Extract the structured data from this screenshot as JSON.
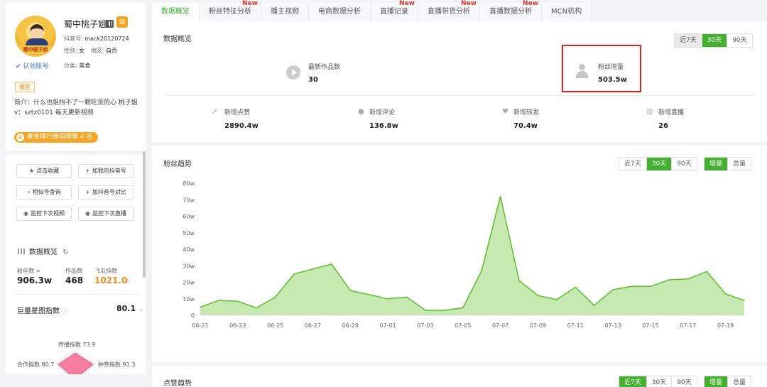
{
  "profile": {
    "name": "蜀中桃子姐",
    "avatar_banner": "蜀中桃子姐",
    "douyin_id_label": "抖音号:",
    "douyin_id": "mack20120724",
    "gender_label": "性别:",
    "gender": "女",
    "region_label": "地区:",
    "region": "自贡",
    "claim": "认领账号",
    "category_label": "分类:",
    "category": "美食",
    "zone_tag": "蜀区",
    "bio": "简介：什么也阻挡不了一颗吃货的心 桃子姐v：sztz0101 每天更新视频",
    "rank": "美食排行榜周榜第 4 名"
  },
  "actions": {
    "favorite": "点击收藏",
    "add_mine": "加我的抖音号",
    "similar": "相似号查询",
    "compare": "加抖音号对比",
    "monitor_video": "监控下次视频",
    "monitor_live": "监控下次直播"
  },
  "overview": {
    "title": "数据概览",
    "fans_label": "粉丝数 >",
    "fans": "906.3w",
    "works_label": "作品数",
    "works": "468",
    "index_label": "飞瓜指数",
    "index": "1021.0",
    "juliang_label": "巨量星图指数",
    "juliang": "80.1"
  },
  "radar": {
    "spread": "传播指数 73.9",
    "coop": "合作指数 80.7",
    "goods": "种草指数 91.3"
  },
  "tabs": [
    {
      "label": "数据概览",
      "new": ""
    },
    {
      "label": "粉丝特征分析",
      "new": "New"
    },
    {
      "label": "播主视频",
      "new": ""
    },
    {
      "label": "电商数据分析",
      "new": ""
    },
    {
      "label": "直播记录",
      "new": "New"
    },
    {
      "label": "直播带货分析",
      "new": "New"
    },
    {
      "label": "直播数据分析",
      "new": "New"
    },
    {
      "label": "MCN机构",
      "new": ""
    }
  ],
  "summary": {
    "title": "数据概览",
    "ranges": [
      "近7天",
      "30天",
      "90天"
    ],
    "latest_works_label": "最新作品数",
    "latest_works": "30",
    "fans_growth_label": "粉丝增量",
    "fans_growth": "503.5w",
    "likes_label": "新增点赞",
    "likes": "2890.4w",
    "comments_label": "新增评论",
    "comments": "136.8w",
    "shares_label": "新增转发",
    "shares": "70.4w",
    "lives_label": "新增直播",
    "lives": "26"
  },
  "fans_trend": {
    "title": "粉丝趋势",
    "ranges": [
      "近7天",
      "30天",
      "90天"
    ],
    "modes": [
      "增量",
      "总量"
    ]
  },
  "likes_trend": {
    "title": "点赞趋势",
    "ranges": [
      "近7天",
      "30天",
      "90天"
    ],
    "modes": [
      "增量",
      "总量"
    ]
  },
  "colors": {
    "accent": "#44b02f",
    "line": "#5cbf2a",
    "area": "#c6e9b2",
    "highlight": "#e0201a",
    "index": "#f08b1c"
  },
  "chart_data": {
    "type": "area",
    "title": "",
    "xlabel": "",
    "ylabel": "",
    "x": [
      "06-21",
      "06-22",
      "06-23",
      "06-24",
      "06-25",
      "06-26",
      "06-27",
      "06-28",
      "06-29",
      "06-30",
      "07-01",
      "07-02",
      "07-03",
      "07-04",
      "07-05",
      "07-06",
      "07-07",
      "07-08",
      "07-09",
      "07-10",
      "07-11",
      "07-12",
      "07-13",
      "07-14",
      "07-15",
      "07-16",
      "07-17",
      "07-18",
      "07-19",
      "07-20"
    ],
    "x_ticks": [
      "06-21",
      "06-23",
      "06-25",
      "06-27",
      "06-29",
      "07-01",
      "07-03",
      "07-05",
      "07-07",
      "07-09",
      "07-11",
      "07-13",
      "07-15",
      "07-17",
      "07-19"
    ],
    "series": [
      {
        "values": [
          5,
          9,
          8.5,
          4.5,
          11,
          25,
          28,
          31,
          15,
          12.5,
          10,
          11,
          3,
          3,
          4.5,
          27,
          72,
          21,
          12,
          9.5,
          17,
          6,
          15.5,
          17.5,
          17.5,
          21.5,
          22,
          26.5,
          13,
          9
        ]
      }
    ],
    "y_ticks": [
      "0",
      "10w",
      "20w",
      "30w",
      "40w",
      "50w",
      "60w",
      "70w",
      "80w"
    ],
    "ylim": [
      0,
      80
    ],
    "grid": false
  }
}
